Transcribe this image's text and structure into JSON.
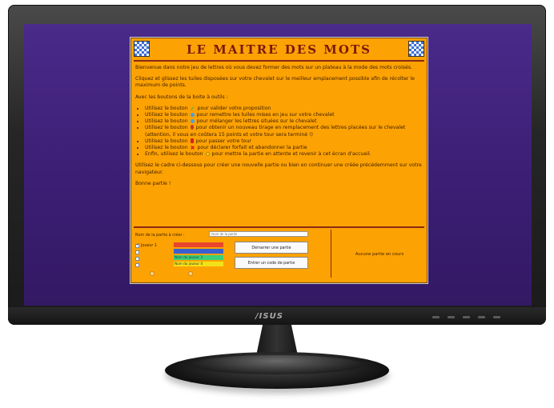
{
  "monitor": {
    "brand": "/ISUS"
  },
  "game": {
    "title": "LE MAITRE DES MOTS",
    "intro1": "Bienvenue dans notre jeu de lettres où vous devez former des mots sur un plateau à la mode des mots croisés.",
    "intro2": "Cliquez et glissez les tuiles disposées sur votre chevalet sur le meilleur emplacement possible afin de récolter le maximum de points.",
    "intro3": "Avec les boutons de la boite à outils :",
    "tools": [
      {
        "icon": "check-icon",
        "text_before": "Utilisez le bouton",
        "text_after": "pour valider votre proposition"
      },
      {
        "icon": "recall-icon",
        "text_before": "Utilisez le bouton",
        "text_after": "pour remettre les tuiles mises en jeu sur votre chevalet"
      },
      {
        "icon": "shuffle-icon",
        "text_before": "Utilisez le bouton",
        "text_after": "pour mélanger les lettres situées sur le chevalet"
      },
      {
        "icon": "exchange-icon",
        "text_before": "Utilisez le bouton",
        "text_after": "pour obtenir un nouveau tirage en remplacement des lettres placées sur le chevalet (attention, il vous en coûtera 15 points et votre tour sera terminé !)"
      },
      {
        "icon": "pass-icon",
        "text_before": "Utilisez le bouton",
        "text_after": "pour passer votre tour"
      },
      {
        "icon": "forfeit-icon",
        "text_before": "Utilisez le bouton",
        "text_after": "pour déclarer forfait et abandonner la partie"
      },
      {
        "icon": "pause-icon",
        "text_before": "Enfin, utilisez le bouton",
        "text_after": "pour mettre la partie en attente et revenir à cet écran d'accueil."
      }
    ],
    "outro1": "Utilisez le cadre ci-dessous pour créer une nouvelle partie ou bien en continuer une créée précédemment sur votre navigateur.",
    "outro2": "Bonne partie !"
  },
  "form": {
    "name_label": "Nom de la partie à créer :",
    "name_placeholder": "Nom de la partie",
    "players": [
      {
        "label": "Joueur 1",
        "checked": true,
        "color": "#e8452c",
        "field_text": ""
      },
      {
        "label": "",
        "checked": false,
        "color": "#3a5fd0",
        "field_text": ""
      },
      {
        "label": "",
        "checked": false,
        "color": "#3ad07a",
        "field_text": "Nom du joueur 3"
      },
      {
        "label": "",
        "checked": false,
        "color": "#f2e21a",
        "field_text": "Nom du joueur 4"
      }
    ],
    "start_button": "Démarrer une partie",
    "code_button": "Entrer un code de partie",
    "radio1": "",
    "radio2": ""
  },
  "saved_games": {
    "empty_text": "Aucune partie en cours"
  }
}
